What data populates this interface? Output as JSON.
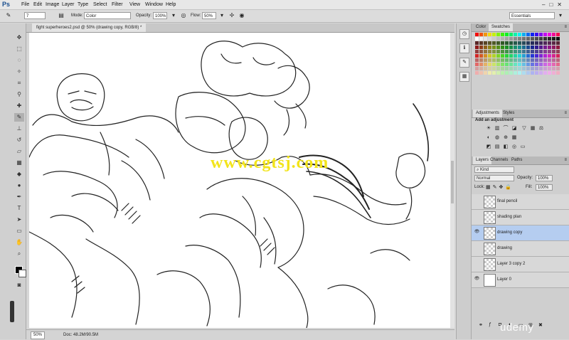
{
  "app": {
    "logo": "Ps"
  },
  "menu": [
    "File",
    "Edit",
    "Image",
    "Layer",
    "Type",
    "Select",
    "Filter",
    "View",
    "Window",
    "Help"
  ],
  "window_controls": "–□✕",
  "options": {
    "brush_size": "7",
    "mode_label": "Mode:",
    "mode_value": "Color",
    "opacity_label": "Opacity:",
    "opacity_value": "100%",
    "flow_label": "Flow:",
    "flow_value": "50%",
    "workspace": "Essentials"
  },
  "document": {
    "title": "fight superheroes2.psd @ 50% (drawing copy, RGB/8) *",
    "zoom": "50%",
    "info": "Doc: 48.2M/90.5M"
  },
  "watermark": "www.cgtsj.com",
  "panels": {
    "color_tabs": [
      "Color",
      "Swatches"
    ],
    "adjust_tabs": [
      "Adjustments",
      "Styles"
    ],
    "adjust_title": "Add an adjustment",
    "layers_tabs": [
      "Layers",
      "Channels",
      "Paths"
    ],
    "kind": "Kind",
    "blend": "Normal",
    "opacity_label": "Opacity:",
    "opacity": "100%",
    "lock_label": "Lock:",
    "fill_label": "Fill:",
    "fill": "100%"
  },
  "layers": [
    {
      "name": "final pencil",
      "visible": false,
      "selected": false
    },
    {
      "name": "shading plan",
      "visible": false,
      "selected": false
    },
    {
      "name": "drawing copy",
      "visible": true,
      "selected": true
    },
    {
      "name": "drawing",
      "visible": false,
      "selected": false
    },
    {
      "name": "Layer 3 copy 2",
      "visible": false,
      "selected": false
    },
    {
      "name": "Layer 0",
      "visible": true,
      "selected": false
    }
  ],
  "branding": "udemy",
  "colors": {
    "selection": "#b5cdf0",
    "watermark": "#f2e41a",
    "logo": "#1b4f8f"
  }
}
